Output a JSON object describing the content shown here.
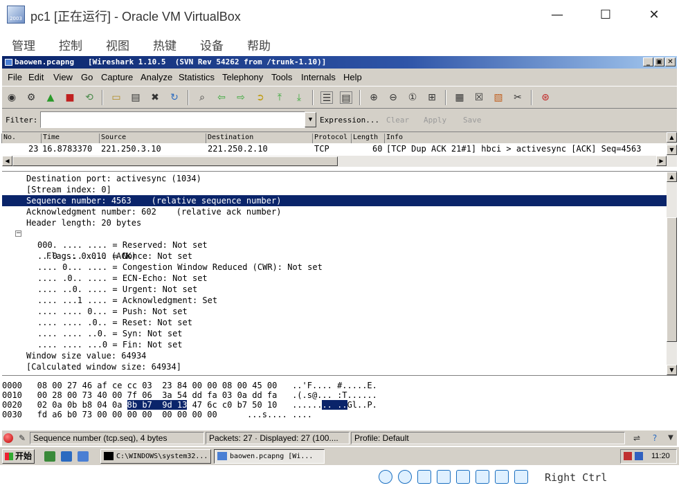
{
  "host": {
    "logo_caption": "2003",
    "title": "pc1 [正在运行] - Oracle VM VirtualBox",
    "controls": {
      "minimize": "—",
      "maximize": "☐",
      "close": "✕"
    },
    "menu": [
      "管理",
      "控制",
      "视图",
      "热键",
      "设备",
      "帮助"
    ],
    "host_key_text": "Right Ctrl"
  },
  "wireshark": {
    "title": "baowen.pcapng   [Wireshark 1.10.5  (SVN Rev 54262 from /trunk-1.10)]",
    "title_controls": {
      "minimize": "_",
      "restore": "▣",
      "close": "✕"
    },
    "menu": [
      "File",
      "Edit",
      "View",
      "Go",
      "Capture",
      "Analyze",
      "Statistics",
      "Telephony",
      "Tools",
      "Internals",
      "Help"
    ],
    "filter": {
      "label": "Filter:",
      "value": "",
      "dropdown": "▼",
      "expression": "Expression...",
      "clear": "Clear",
      "apply": "Apply",
      "save": "Save"
    },
    "packet_list": {
      "columns": [
        "No.",
        "Time",
        "Source",
        "Destination",
        "Protocol",
        "Length",
        "Info"
      ],
      "rows": [
        {
          "no": "23",
          "time": "16.8783370",
          "source": "221.250.3.10",
          "destination": "221.250.2.10",
          "protocol": "TCP",
          "length": "60",
          "info": "[TCP Dup ACK 21#1] hbci > activesync [ACK] Seq=4563"
        }
      ]
    },
    "details": [
      {
        "text": "Destination port: activesync (1034)",
        "indent": 1
      },
      {
        "text": "[Stream index: 0]",
        "indent": 1
      },
      {
        "text": "Sequence number: 4563    (relative sequence number)",
        "indent": 1,
        "selected": true
      },
      {
        "text": "Acknowledgment number: 602    (relative ack number)",
        "indent": 1
      },
      {
        "text": "Header length: 20 bytes",
        "indent": 1
      },
      {
        "text": "Flags: 0x010 (ACK)",
        "indent": 1,
        "expander": "⊟"
      },
      {
        "text": "000. .... .... = Reserved: Not set",
        "indent": 2
      },
      {
        "text": "...0 .... .... = Nonce: Not set",
        "indent": 2
      },
      {
        "text": ".... 0... .... = Congestion Window Reduced (CWR): Not set",
        "indent": 2
      },
      {
        "text": ".... .0.. .... = ECN-Echo: Not set",
        "indent": 2
      },
      {
        "text": ".... ..0. .... = Urgent: Not set",
        "indent": 2
      },
      {
        "text": ".... ...1 .... = Acknowledgment: Set",
        "indent": 2
      },
      {
        "text": ".... .... 0... = Push: Not set",
        "indent": 2
      },
      {
        "text": ".... .... .0.. = Reset: Not set",
        "indent": 2
      },
      {
        "text": ".... .... ..0. = Syn: Not set",
        "indent": 2
      },
      {
        "text": ".... .... ...0 = Fin: Not set",
        "indent": 2
      },
      {
        "text": "Window size value: 64934",
        "indent": 1
      },
      {
        "text": "[Calculated window size: 64934]",
        "indent": 1
      }
    ],
    "hex": [
      {
        "offset": "0000",
        "pre": "08 00 27 46 af ce cc 03  23 84 00 00 08 00 45 00",
        "sel": "",
        "post": "",
        "ascii_pre": "..'F.... #.....E.",
        "ascii_sel": "",
        "ascii_post": ""
      },
      {
        "offset": "0010",
        "pre": "00 28 00 73 40 00 7f 06  3a 54 dd fa 03 0a dd fa",
        "sel": "",
        "post": "",
        "ascii_pre": ".(.s@... :T......",
        "ascii_sel": "",
        "ascii_post": ""
      },
      {
        "offset": "0020",
        "pre": "02 0a 0b b8 04 0a ",
        "sel": "8b b7  9d 13",
        "post": " 47 6c c0 b7 50 10",
        "ascii_pre": "......",
        "ascii_sel": ".. ..",
        "ascii_post": "Gl..P."
      },
      {
        "offset": "0030",
        "pre": "fd a6 b0 73 00 00 00 00  00 00 00 00",
        "sel": "",
        "post": "",
        "ascii_pre": "...s.... ....",
        "ascii_sel": "",
        "ascii_post": ""
      }
    ],
    "status": {
      "field_info": "Sequence number (tcp.seq), 4 bytes",
      "packets": "Packets: 27 · Displayed: 27 (100....",
      "profile": "Profile: Default"
    }
  },
  "guest_taskbar": {
    "start": "开始",
    "tasks": [
      {
        "label": "C:\\WINDOWS\\system32...",
        "active": false
      },
      {
        "label": "baowen.pcapng    [Wi...",
        "active": true
      }
    ],
    "clock": "11:20"
  },
  "colors": {
    "selection": "#0a246a",
    "title_gradient_start": "#0a246a",
    "title_gradient_end": "#a6caf0",
    "classic_face": "#d4d0c8"
  }
}
